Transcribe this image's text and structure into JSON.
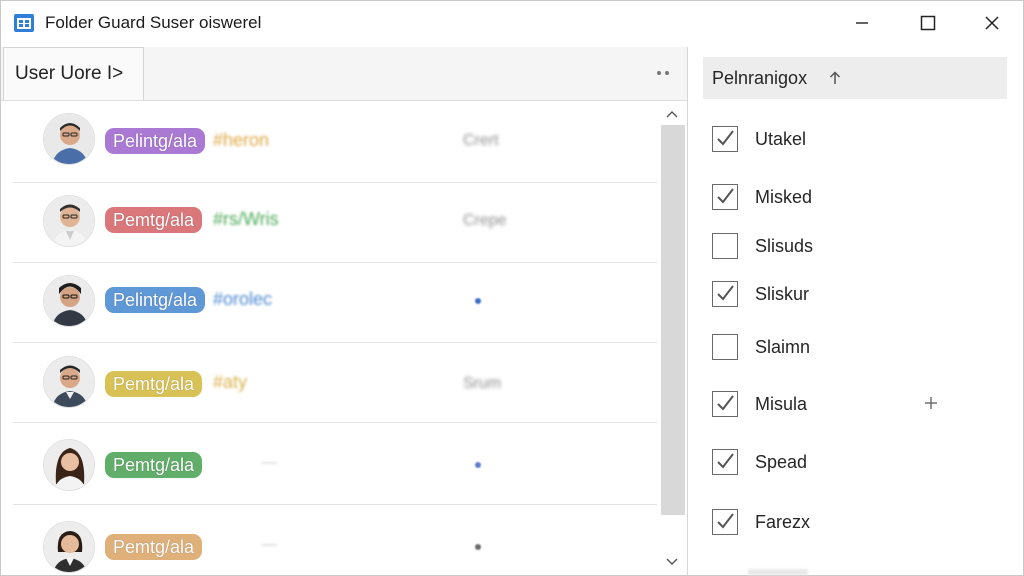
{
  "window": {
    "title": "Folder Guard Suser oiswerel"
  },
  "left_pane": {
    "tab_label": "User Uore I>",
    "rows": [
      {
        "badge": "Pelintg/ala",
        "badge_color": "#a979d4",
        "tag": "#heron",
        "tag_color": "#e0a845",
        "status": "Crert",
        "dot_color": ""
      },
      {
        "badge": "Pemtg/ala",
        "badge_color": "#d9777a",
        "tag": "#rs/Wris",
        "tag_color": "#4caa56",
        "status": "Crepe",
        "dot_color": ""
      },
      {
        "badge": "Pelintg/ala",
        "badge_color": "#5f98d6",
        "tag": "#orolec",
        "tag_color": "#4a88d0",
        "status": "",
        "dot_color": "#3f6fc7"
      },
      {
        "badge": "Pemtg/ala",
        "badge_color": "#d8c255",
        "tag": "#aty",
        "tag_color": "#d9b14a",
        "status": "Srum",
        "dot_color": ""
      },
      {
        "badge": "Pemtg/ala",
        "badge_color": "#61ad6a",
        "tag": "—",
        "tag_color": "#c9c9c9",
        "status": "",
        "dot_color": "#5b7fcc"
      },
      {
        "badge": "Pemtg/ala",
        "badge_color": "#dfb07a",
        "tag": "—",
        "tag_color": "#c9c9c9",
        "status": "",
        "dot_color": "#6b6b6b"
      }
    ]
  },
  "right_pane": {
    "header": "Pelnranigox",
    "items": [
      {
        "label": "Utakel",
        "checked": true
      },
      {
        "label": "Misked",
        "checked": true
      },
      {
        "label": "Slisuds",
        "checked": false
      },
      {
        "label": "Sliskur",
        "checked": true
      },
      {
        "label": "Slaimn",
        "checked": false
      },
      {
        "label": "Misula",
        "checked": true
      },
      {
        "label": "Spead",
        "checked": true
      },
      {
        "label": "Farezx",
        "checked": true
      }
    ]
  },
  "colors": {
    "accent": "#2b7bd6",
    "checkbox_border": "#6a6a6a",
    "scroll_track": "#d8d8d8"
  }
}
